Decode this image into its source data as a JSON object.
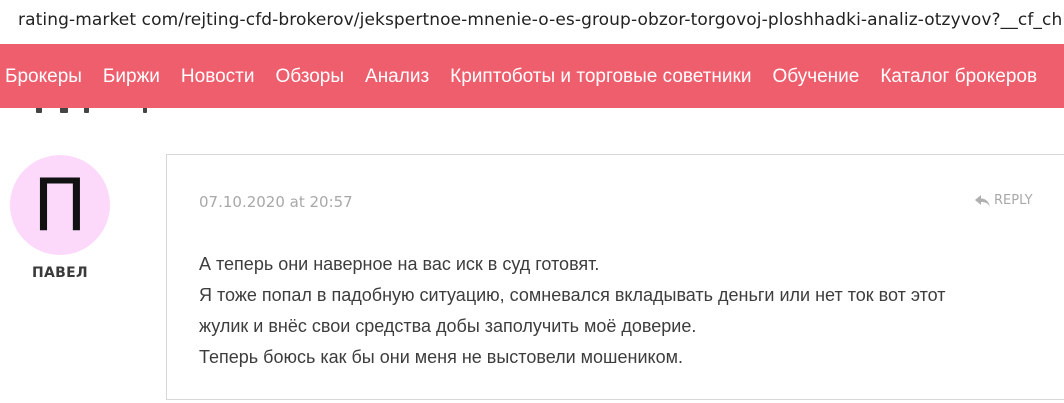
{
  "browser": {
    "url": "rating-market com/rejting-cfd-brokerov/jekspertnoe-mnenie-o-es-group-obzor-torgovoj-ploshhadki-analiz-otzyvov?__cf_chl_jschl_tk__="
  },
  "nav": {
    "items": [
      {
        "label": "Брокеры"
      },
      {
        "label": "Биржи"
      },
      {
        "label": "Новости"
      },
      {
        "label": "Обзоры"
      },
      {
        "label": "Анализ"
      },
      {
        "label": "Криптоботы и торговые советники"
      },
      {
        "label": "Обучение"
      },
      {
        "label": "Каталог брокеров"
      }
    ]
  },
  "comment": {
    "author": {
      "initial": "П",
      "name": "ПАВЕЛ"
    },
    "date": "07.10.2020 at 20:57",
    "reply_label": "REPLY",
    "lines": [
      "А теперь они наверное на вас иск в суд готовят.",
      "Я тоже попал в падобную ситуацию, сомневался вкладывать деньги или нет ток вот этот",
      "жулик и внёс свои средства добы заполучить моё доверие.",
      "Теперь боюсь как бы они меня не выстовели мошеником."
    ]
  },
  "colors": {
    "accent": "#ef5e6d",
    "avatar_bg": "#fcd9fb",
    "muted_text": "#a8a8a8",
    "body_text": "#3d3d3d"
  },
  "icons": {
    "reply": "reply-arrow-icon"
  }
}
